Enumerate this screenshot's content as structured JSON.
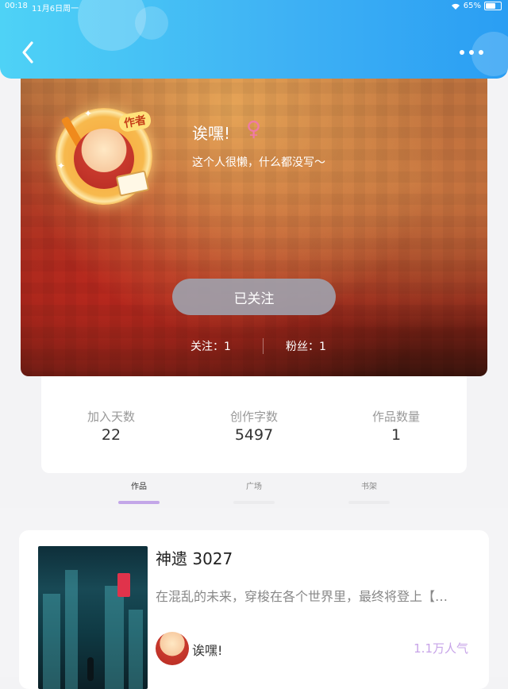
{
  "status_bar": {
    "time": "00:18",
    "date": "11月6日周一",
    "battery": "65%",
    "battery_level": 0.65
  },
  "header": {
    "back_icon": "chevron-left-icon",
    "more_icon": "more-dots-icon"
  },
  "profile": {
    "nickname": "诶嘿!",
    "gender_symbol": "♀",
    "bio": "这个人很懒，什么都没写～",
    "author_badge": "作者",
    "follow_button": "已关注",
    "following": "关注：1",
    "fans": "粉丝：1"
  },
  "stats": [
    {
      "label": "加入天数",
      "value": "22"
    },
    {
      "label": "创作字数",
      "value": "5497"
    },
    {
      "label": "作品数量",
      "value": "1"
    }
  ],
  "tabs": [
    {
      "label": "作品",
      "active": true
    },
    {
      "label": "广场",
      "active": false
    },
    {
      "label": "书架",
      "active": false
    }
  ],
  "works": [
    {
      "title": "神遗 3027",
      "description": "在混乱的未来，穿梭在各个世界里，最终将登上【…",
      "author": "诶嘿!",
      "popularity": "1.1万人气"
    }
  ],
  "colors": {
    "header_accent": "#3fb2f4",
    "tab_active": "#c3a6e8",
    "popularity": "#c7a4e8",
    "gender": "#f07aa6"
  }
}
